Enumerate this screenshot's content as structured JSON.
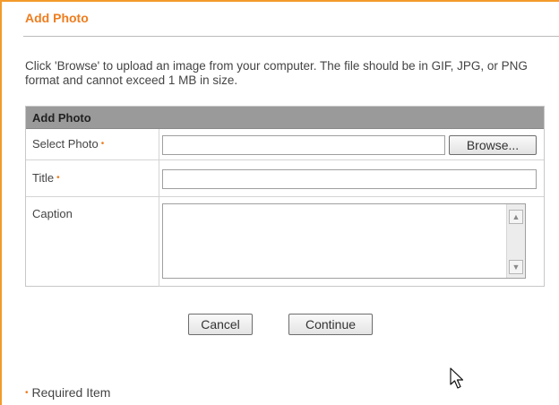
{
  "panel": {
    "title": "Add Photo",
    "intro": "Click 'Browse' to upload an image from your computer. The file should be in GIF, JPG, or PNG format and cannot exceed 1 MB in size."
  },
  "form": {
    "header": "Add Photo",
    "required_marker": "•",
    "fields": {
      "select_photo": {
        "label": "Select Photo",
        "required": true,
        "value": ""
      },
      "title": {
        "label": "Title",
        "required": true,
        "value": ""
      },
      "caption": {
        "label": "Caption",
        "required": false,
        "value": ""
      }
    },
    "browse_label": "Browse..."
  },
  "actions": {
    "cancel_label": "Cancel",
    "continue_label": "Continue"
  },
  "footer": {
    "required_marker": "•",
    "required_note": "Required Item"
  },
  "icons": {
    "scroll_up": "scroll-up-arrow-icon",
    "scroll_down": "scroll-down-arrow-icon",
    "cursor": "mouse-pointer-icon"
  },
  "colors": {
    "accent": "#ee7d1e",
    "border_accent": "#f39a2c",
    "header_bar": "#9a9a9a"
  }
}
